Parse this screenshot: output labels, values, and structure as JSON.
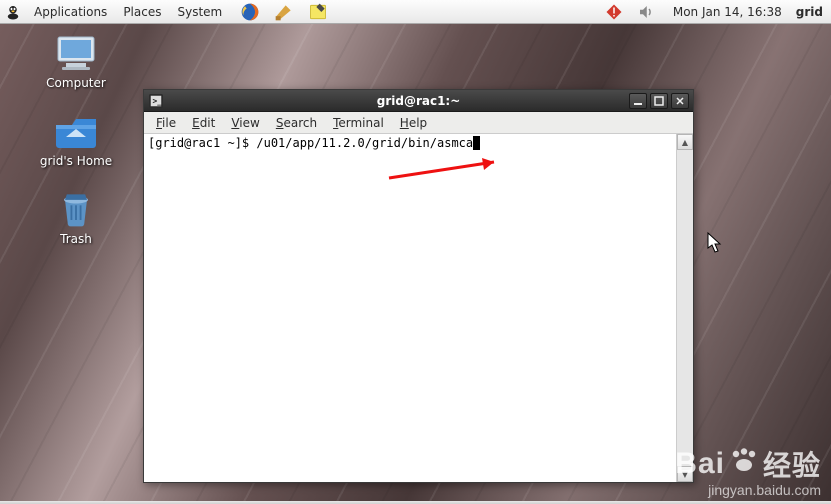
{
  "panel": {
    "menus": [
      "Applications",
      "Places",
      "System"
    ],
    "launchers": [
      "firefox-icon",
      "help-icon",
      "notes-icon"
    ],
    "tray": [
      "update-alert-icon",
      "volume-icon"
    ],
    "clock": "Mon Jan 14, 16:38",
    "user": "grid"
  },
  "desktop_icons": [
    {
      "name": "computer-icon",
      "label": "Computer"
    },
    {
      "name": "home-folder-icon",
      "label": "grid's Home"
    },
    {
      "name": "trash-icon",
      "label": "Trash"
    }
  ],
  "terminal": {
    "title": "grid@rac1:~",
    "menus": [
      {
        "label": "File",
        "u": "F"
      },
      {
        "label": "Edit",
        "u": "E"
      },
      {
        "label": "View",
        "u": "V"
      },
      {
        "label": "Search",
        "u": "S"
      },
      {
        "label": "Terminal",
        "u": "T"
      },
      {
        "label": "Help",
        "u": "H"
      }
    ],
    "prompt": "[grid@rac1 ~]$ ",
    "command": "/u01/app/11.2.0/grid/bin/asmca"
  },
  "watermark": {
    "brand": "Bai",
    "brand_cn": "经验",
    "url": "jingyan.baidu.com"
  }
}
